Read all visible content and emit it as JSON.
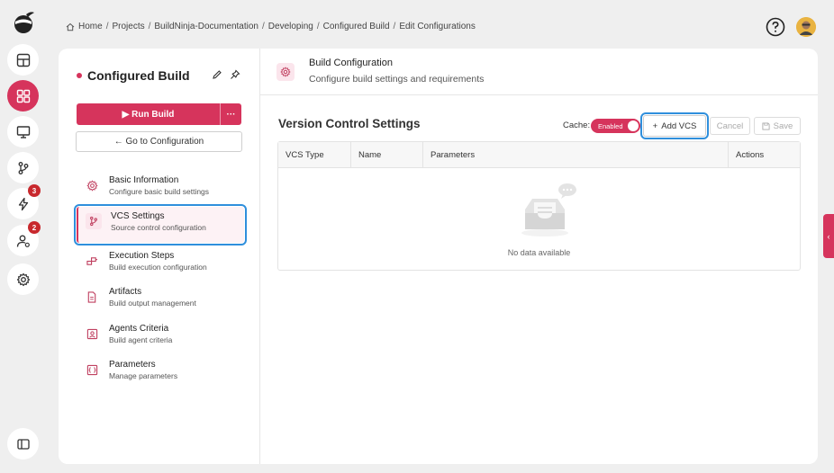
{
  "breadcrumb": {
    "items": [
      "Home",
      "Projects",
      "BuildNinja-Documentation",
      "Developing",
      "Configured Build",
      "Edit Configurations"
    ],
    "separator": "/"
  },
  "rail": {
    "badges": {
      "builds": "3",
      "agents": "2"
    }
  },
  "left_panel": {
    "title": "Configured Build",
    "run_label": "Run Build",
    "more_label": "···",
    "goto_label": "← Go to Configuration",
    "nav": [
      {
        "title": "Basic Information",
        "subtitle": "Configure basic build settings",
        "icon": "settings-icon"
      },
      {
        "title": "VCS Settings",
        "subtitle": "Source control configuration",
        "icon": "branch-icon"
      },
      {
        "title": "Execution Steps",
        "subtitle": "Build execution configuration",
        "icon": "steps-icon"
      },
      {
        "title": "Artifacts",
        "subtitle": "Build output management",
        "icon": "file-icon"
      },
      {
        "title": "Agents Criteria",
        "subtitle": "Build agent criteria",
        "icon": "agent-icon"
      },
      {
        "title": "Parameters",
        "subtitle": "Manage parameters",
        "icon": "parameters-icon"
      }
    ]
  },
  "main": {
    "header_title": "Build Configuration",
    "header_subtitle": "Configure build settings and requirements",
    "section_title": "Version Control Settings",
    "cache_label": "Cache:",
    "cache_toggle": "Enabled",
    "add_vcs_label": "Add VCS",
    "cancel_label": "Cancel",
    "save_label": "Save",
    "table": {
      "columns": [
        "VCS Type",
        "Name",
        "Parameters",
        "Actions"
      ],
      "empty_text": "No data available"
    }
  },
  "colors": {
    "accent": "#d6345c",
    "highlight": "#2f8fdc"
  }
}
